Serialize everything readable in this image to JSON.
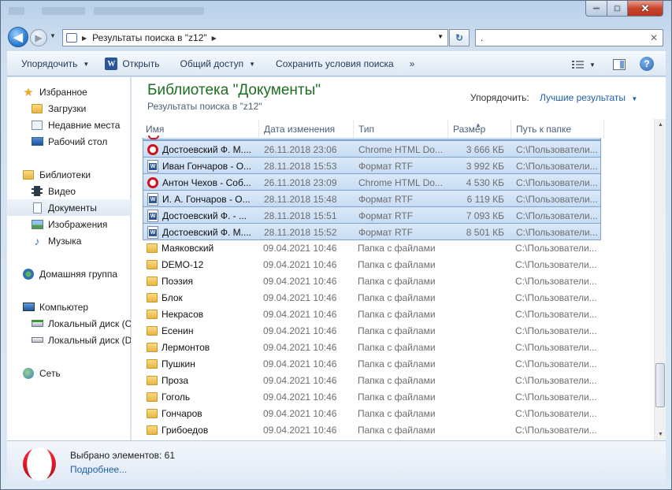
{
  "window": {
    "min": "─",
    "max": "□",
    "close": "✕"
  },
  "nav": {
    "back": "◀",
    "forward": "▶"
  },
  "address": {
    "text": "Результаты поиска в \"z12\""
  },
  "search": {
    "value": "."
  },
  "toolbar": {
    "organize": "Упорядочить",
    "open": "Открыть",
    "share": "Общий доступ",
    "save_search": "Сохранить условия поиска",
    "more": "»"
  },
  "sidebar": {
    "favorites": "Избранное",
    "downloads": "Загрузки",
    "recent": "Недавние места",
    "desktop": "Рабочий стол",
    "libraries": "Библиотеки",
    "video": "Видео",
    "documents": "Документы",
    "images": "Изображения",
    "music": "Музыка",
    "homegroup": "Домашняя группа",
    "computer": "Компьютер",
    "disk_c": "Локальный диск (C",
    "disk_d": "Локальный диск (D",
    "network": "Сеть"
  },
  "library": {
    "title": "Библиотека \"Документы\"",
    "subtitle": "Результаты поиска в \"z12\"",
    "sort_label": "Упорядочить:",
    "sort_value": "Лучшие результаты"
  },
  "columns": {
    "name": "Имя",
    "date": "Дата изменения",
    "type": "Тип",
    "size": "Размер",
    "path": "Путь к папке"
  },
  "rows": [
    {
      "icon": "opera",
      "name": "Достоевский Ф. М....",
      "date": "26.11.2018 23:06",
      "type": "Chrome HTML Do...",
      "size": "3 666 КБ",
      "path": "C:\\Пользователи...",
      "selected": true
    },
    {
      "icon": "rtf",
      "name": "Иван Гончаров - О...",
      "date": "28.11.2018 15:53",
      "type": "Формат RTF",
      "size": "3 992 КБ",
      "path": "C:\\Пользователи...",
      "selected": true
    },
    {
      "icon": "opera",
      "name": "Антон Чехов - Соб...",
      "date": "26.11.2018 23:09",
      "type": "Chrome HTML Do...",
      "size": "4 530 КБ",
      "path": "C:\\Пользователи...",
      "selected": true
    },
    {
      "icon": "rtf",
      "name": "И. А. Гончаров - О...",
      "date": "28.11.2018 15:48",
      "type": "Формат RTF",
      "size": "6 119 КБ",
      "path": "C:\\Пользователи...",
      "selected": true
    },
    {
      "icon": "rtf",
      "name": "Достоевский Ф. - ...",
      "date": "28.11.2018 15:51",
      "type": "Формат RTF",
      "size": "7 093 КБ",
      "path": "C:\\Пользователи...",
      "selected": true
    },
    {
      "icon": "rtf",
      "name": "Достоевский Ф. М....",
      "date": "28.11.2018 15:52",
      "type": "Формат RTF",
      "size": "8 501 КБ",
      "path": "C:\\Пользователи...",
      "selected": true
    },
    {
      "icon": "folder",
      "name": "Маяковский",
      "date": "09.04.2021 10:46",
      "type": "Папка с файлами",
      "size": "",
      "path": "C:\\Пользователи...",
      "selected": false
    },
    {
      "icon": "folder",
      "name": "DEMO-12",
      "date": "09.04.2021 10:46",
      "type": "Папка с файлами",
      "size": "",
      "path": "C:\\Пользователи...",
      "selected": false
    },
    {
      "icon": "folder",
      "name": "Поэзия",
      "date": "09.04.2021 10:46",
      "type": "Папка с файлами",
      "size": "",
      "path": "C:\\Пользователи...",
      "selected": false
    },
    {
      "icon": "folder",
      "name": "Блок",
      "date": "09.04.2021 10:46",
      "type": "Папка с файлами",
      "size": "",
      "path": "C:\\Пользователи...",
      "selected": false
    },
    {
      "icon": "folder",
      "name": "Некрасов",
      "date": "09.04.2021 10:46",
      "type": "Папка с файлами",
      "size": "",
      "path": "C:\\Пользователи...",
      "selected": false
    },
    {
      "icon": "folder",
      "name": "Есенин",
      "date": "09.04.2021 10:46",
      "type": "Папка с файлами",
      "size": "",
      "path": "C:\\Пользователи...",
      "selected": false
    },
    {
      "icon": "folder",
      "name": "Лермонтов",
      "date": "09.04.2021 10:46",
      "type": "Папка с файлами",
      "size": "",
      "path": "C:\\Пользователи...",
      "selected": false
    },
    {
      "icon": "folder",
      "name": "Пушкин",
      "date": "09.04.2021 10:46",
      "type": "Папка с файлами",
      "size": "",
      "path": "C:\\Пользователи...",
      "selected": false
    },
    {
      "icon": "folder",
      "name": "Проза",
      "date": "09.04.2021 10:46",
      "type": "Папка с файлами",
      "size": "",
      "path": "C:\\Пользователи...",
      "selected": false
    },
    {
      "icon": "folder",
      "name": "Гоголь",
      "date": "09.04.2021 10:46",
      "type": "Папка с файлами",
      "size": "",
      "path": "C:\\Пользователи...",
      "selected": false
    },
    {
      "icon": "folder",
      "name": "Гончаров",
      "date": "09.04.2021 10:46",
      "type": "Папка с файлами",
      "size": "",
      "path": "C:\\Пользователи...",
      "selected": false
    },
    {
      "icon": "folder",
      "name": "Грибоедов",
      "date": "09.04.2021 10:46",
      "type": "Папка с файлами",
      "size": "",
      "path": "C:\\Пользователи...",
      "selected": false
    }
  ],
  "status": {
    "selected": "Выбрано элементов: 61",
    "more": "Подробнее..."
  }
}
